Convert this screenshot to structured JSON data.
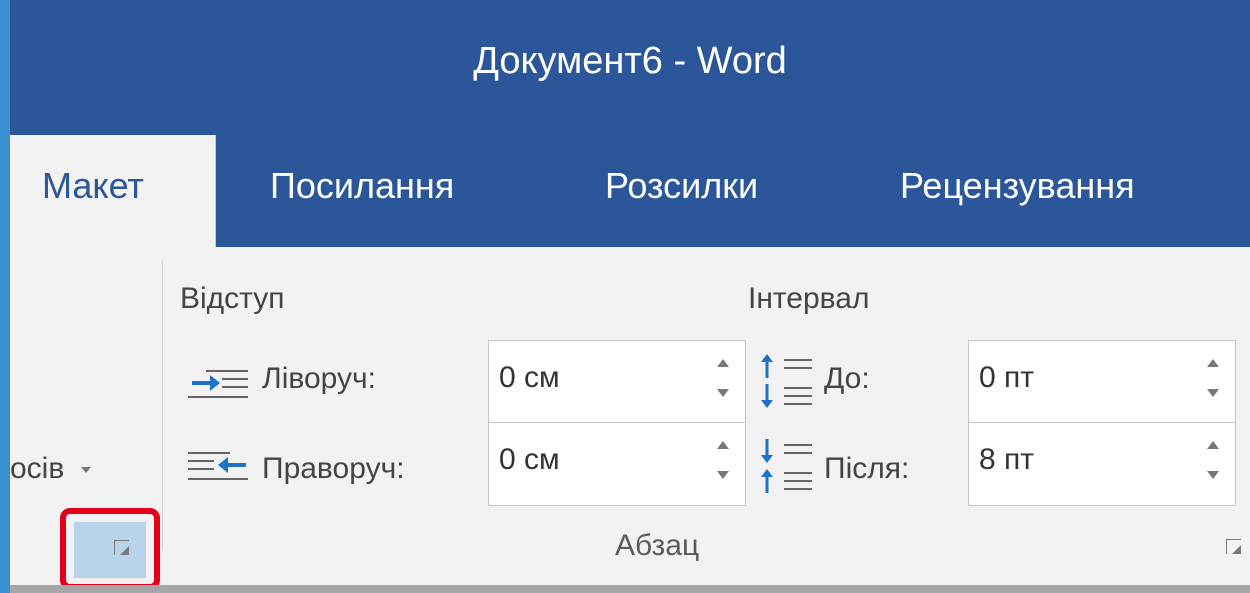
{
  "window": {
    "title": "Документ6 - Word"
  },
  "tabs": [
    {
      "label": "Макет",
      "active": true
    },
    {
      "label": "Посилання"
    },
    {
      "label": "Розсилки"
    },
    {
      "label": "Рецензування"
    }
  ],
  "left_group": {
    "partial_label": "осів",
    "dropdown_icon": "chevron-down-icon"
  },
  "paragraph": {
    "group_label": "Абзац",
    "indent": {
      "heading": "Відступ",
      "left": {
        "label": "Ліворуч:",
        "value": "0 см",
        "icon": "indent-left-icon"
      },
      "right": {
        "label": "Праворуч:",
        "value": "0 см",
        "icon": "indent-right-icon"
      }
    },
    "spacing": {
      "heading": "Інтервал",
      "before": {
        "label": "До:",
        "value": "0 пт",
        "icon": "spacing-before-icon"
      },
      "after": {
        "label": "Після:",
        "value": "8 пт",
        "icon": "spacing-after-icon"
      }
    }
  },
  "colors": {
    "ribbon_blue": "#2b579a",
    "ribbon_bg": "#f2f2f2",
    "highlight_red": "#e3001b"
  }
}
